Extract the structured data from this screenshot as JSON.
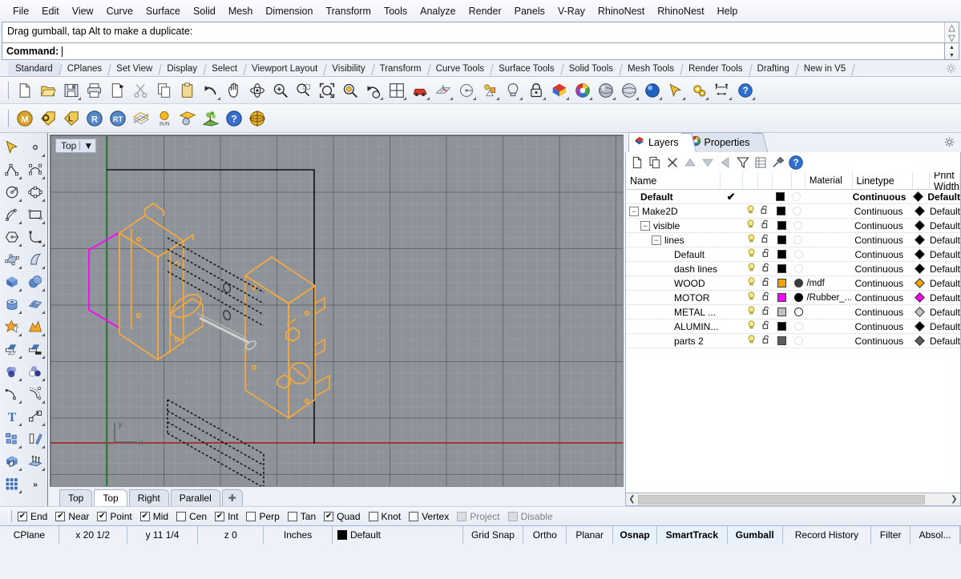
{
  "menu": {
    "items": [
      "File",
      "Edit",
      "View",
      "Curve",
      "Surface",
      "Solid",
      "Mesh",
      "Dimension",
      "Transform",
      "Tools",
      "Analyze",
      "Render",
      "Panels",
      "V-Ray",
      "RhinoNest",
      "RhinoNest",
      "Help"
    ]
  },
  "command": {
    "history": "Drag gumball, tap Alt to make a duplicate:",
    "prompt_label": "Command:",
    "input_value": "",
    "input_placeholder": ""
  },
  "toolbar_tabs": {
    "items": [
      "Standard",
      "CPlanes",
      "Set View",
      "Display",
      "Select",
      "Viewport Layout",
      "Visibility",
      "Transform",
      "Curve Tools",
      "Surface Tools",
      "Solid Tools",
      "Mesh Tools",
      "Render Tools",
      "Drafting",
      "New in V5"
    ],
    "active": "Standard",
    "options_icon": "gear-icon"
  },
  "main_toolbar_row1": [
    {
      "icon": "new-file-icon",
      "flyout": false
    },
    {
      "icon": "open-folder-icon",
      "flyout": false
    },
    {
      "icon": "save-icon",
      "flyout": true
    },
    {
      "icon": "print-icon",
      "flyout": false
    },
    {
      "icon": "properties-page-icon",
      "flyout": false
    },
    {
      "icon": "cut-scissors-icon",
      "flyout": false
    },
    {
      "icon": "copy-icon",
      "flyout": false
    },
    {
      "icon": "paste-clipboard-icon",
      "flyout": false
    },
    {
      "icon": "undo-arrow-icon",
      "flyout": true
    },
    {
      "icon": "pan-hand-icon",
      "flyout": false
    },
    {
      "icon": "rotate-view-icon",
      "flyout": false
    },
    {
      "icon": "zoom-in-icon",
      "flyout": false
    },
    {
      "icon": "zoom-window-icon",
      "flyout": false
    },
    {
      "icon": "zoom-extents-icon",
      "flyout": false
    },
    {
      "icon": "zoom-selected-icon",
      "flyout": false
    },
    {
      "icon": "zoom-dynamic-icon",
      "flyout": true
    },
    {
      "icon": "four-viewport-icon",
      "flyout": true
    },
    {
      "icon": "named-view-car-icon",
      "flyout": true
    },
    {
      "icon": "cplane-grid-icon",
      "flyout": true
    },
    {
      "icon": "set-cplane-icon",
      "flyout": true
    },
    {
      "icon": "layout-objects-icon",
      "flyout": true
    },
    {
      "icon": "light-bulb-icon",
      "flyout": true
    },
    {
      "icon": "lock-icon",
      "flyout": true
    },
    {
      "icon": "render-color-icon",
      "flyout": true
    },
    {
      "icon": "color-wheel-icon",
      "flyout": true
    },
    {
      "icon": "shaded-sphere-icon",
      "flyout": true
    },
    {
      "icon": "ghosted-sphere-icon",
      "flyout": true
    },
    {
      "icon": "rendered-sphere-icon",
      "flyout": true
    },
    {
      "icon": "select-arrow-icon",
      "flyout": true
    },
    {
      "icon": "options-gears-icon",
      "flyout": true
    },
    {
      "icon": "dimension-icon",
      "flyout": true
    },
    {
      "icon": "help-icon",
      "flyout": true
    }
  ],
  "main_toolbar_row2": [
    {
      "icon": "m-badge-icon"
    },
    {
      "icon": "o-tag-icon"
    },
    {
      "icon": "l-tag-icon"
    },
    {
      "icon": "r-render-icon"
    },
    {
      "icon": "rt-realtime-icon"
    },
    {
      "icon": "mesh-lines-icon"
    },
    {
      "icon": "sun-icon"
    },
    {
      "icon": "ground-plane-icon"
    },
    {
      "icon": "plant-library-icon"
    },
    {
      "icon": "help-question-icon"
    },
    {
      "icon": "target-globe-icon"
    }
  ],
  "left_toolbar": [
    {
      "icon": "select-arrow-icon",
      "flyout": false
    },
    {
      "icon": "point-object-icon",
      "flyout": true
    },
    {
      "icon": "polyline-icon",
      "flyout": true
    },
    {
      "icon": "control-point-curve-icon",
      "flyout": true
    },
    {
      "icon": "circle-icon",
      "flyout": true
    },
    {
      "icon": "ellipse-icon",
      "flyout": true
    },
    {
      "icon": "arc-icon",
      "flyout": true
    },
    {
      "icon": "rectangle-icon",
      "flyout": true
    },
    {
      "icon": "polygon-icon",
      "flyout": true
    },
    {
      "icon": "curve-fillet-icon",
      "flyout": true
    },
    {
      "icon": "surface-from-points-icon",
      "flyout": true
    },
    {
      "icon": "surface-sweep-icon",
      "flyout": true
    },
    {
      "icon": "box-solid-icon",
      "flyout": true
    },
    {
      "icon": "sphere-solid-icon",
      "flyout": true
    },
    {
      "icon": "cylinder-solid-icon",
      "flyout": true
    },
    {
      "icon": "mesh-plane-icon",
      "flyout": true
    },
    {
      "icon": "boolean-union-icon",
      "flyout": true
    },
    {
      "icon": "explode-icon",
      "flyout": true
    },
    {
      "icon": "trim-icon",
      "flyout": true
    },
    {
      "icon": "split-icon",
      "flyout": true
    },
    {
      "icon": "boolean-difference-icon",
      "flyout": true
    },
    {
      "icon": "boolean-intersection-icon",
      "flyout": true
    },
    {
      "icon": "fillet-curve-icon",
      "flyout": true
    },
    {
      "icon": "offset-curve-icon",
      "flyout": true
    },
    {
      "icon": "text-tool-icon",
      "flyout": true
    },
    {
      "icon": "scale-icon",
      "flyout": true
    },
    {
      "icon": "group-objects-icon",
      "flyout": true
    },
    {
      "icon": "mirror-icon",
      "flyout": true
    },
    {
      "icon": "cap-solid-icon",
      "flyout": true
    },
    {
      "icon": "extrude-icon",
      "flyout": true
    },
    {
      "icon": "array-icon",
      "flyout": true
    },
    {
      "icon": "more-tools-icon",
      "flyout": false
    }
  ],
  "viewport": {
    "label": "Top",
    "dropdown_icon": "chevron-down-icon",
    "axis_x_label": "x",
    "axis_y_label": "y",
    "background_color": "#8e9399",
    "x_axis_color": "#9e3a3a",
    "y_axis_color": "#2f7a36",
    "model_color": "#f5a83c",
    "model_selected_color": "#ff00ff",
    "tabs": [
      {
        "label": "Top",
        "active": false
      },
      {
        "label": "Top",
        "active": true
      },
      {
        "label": "Right",
        "active": false
      },
      {
        "label": "Parallel",
        "active": false
      },
      {
        "label": "+",
        "active": false
      }
    ]
  },
  "layers_panel": {
    "tabs": [
      {
        "label": "Layers",
        "icon": "layers-icon",
        "active": true
      },
      {
        "label": "Properties",
        "icon": "properties-icon",
        "active": false
      }
    ],
    "options_icon": "gear-icon",
    "toolbar": [
      {
        "icon": "new-layer-icon"
      },
      {
        "icon": "duplicate-layer-icon"
      },
      {
        "icon": "delete-layer-icon"
      },
      {
        "icon": "move-up-icon"
      },
      {
        "icon": "move-down-icon"
      },
      {
        "icon": "move-left-icon"
      },
      {
        "icon": "filter-icon"
      },
      {
        "icon": "layer-panel-icon"
      },
      {
        "icon": "tools-hammer-icon"
      },
      {
        "icon": "help-icon"
      }
    ],
    "columns": [
      "Name",
      "",
      "",
      "",
      "Material",
      "Linetype",
      "",
      "Print Width"
    ],
    "rows": [
      {
        "name": "Default",
        "indent": 0,
        "expander": "none",
        "current": true,
        "vis": false,
        "lock": false,
        "color": "#000000",
        "mat_circle": "empty",
        "material": "",
        "linetype": "Continuous",
        "pw_color": "#000000",
        "printwidth": "Default",
        "bold": true
      },
      {
        "name": "Make2D",
        "indent": 0,
        "expander": "minus",
        "current": false,
        "vis": true,
        "lock": true,
        "color": "#000000",
        "mat_circle": "empty",
        "material": "",
        "linetype": "Continuous",
        "pw_color": "#000000",
        "printwidth": "Default",
        "bold": false
      },
      {
        "name": "visible",
        "indent": 1,
        "expander": "minus",
        "current": false,
        "vis": true,
        "lock": true,
        "color": "#000000",
        "mat_circle": "empty",
        "material": "",
        "linetype": "Continuous",
        "pw_color": "#000000",
        "printwidth": "Default",
        "bold": false
      },
      {
        "name": "lines",
        "indent": 2,
        "expander": "minus",
        "current": false,
        "vis": true,
        "lock": true,
        "color": "#000000",
        "mat_circle": "empty",
        "material": "",
        "linetype": "Continuous",
        "pw_color": "#000000",
        "printwidth": "Default",
        "bold": false
      },
      {
        "name": "Default",
        "indent": 3,
        "expander": "none",
        "current": false,
        "vis": true,
        "lock": true,
        "color": "#000000",
        "mat_circle": "empty",
        "material": "",
        "linetype": "Continuous",
        "pw_color": "#000000",
        "printwidth": "Default",
        "bold": false
      },
      {
        "name": "dash lines",
        "indent": 3,
        "expander": "none",
        "current": false,
        "vis": true,
        "lock": true,
        "color": "#000000",
        "mat_circle": "empty",
        "material": "",
        "linetype": "Continuous",
        "pw_color": "#000000",
        "printwidth": "Default",
        "bold": false
      },
      {
        "name": "WOOD",
        "indent": 3,
        "expander": "none",
        "current": false,
        "vis": true,
        "lock": true,
        "color": "#f5a300",
        "mat_circle": "#3b3b3b",
        "material": "/mdf",
        "linetype": "Continuous",
        "pw_color": "#f5a300",
        "printwidth": "Default",
        "bold": false
      },
      {
        "name": "MOTOR",
        "indent": 3,
        "expander": "none",
        "current": false,
        "vis": true,
        "lock": true,
        "color": "#ff00ff",
        "mat_circle": "#000000",
        "material": "/Rubber_...",
        "linetype": "Continuous",
        "pw_color": "#ff00ff",
        "printwidth": "Default",
        "bold": false
      },
      {
        "name": "METAL ...",
        "indent": 3,
        "expander": "none",
        "current": false,
        "vis": true,
        "lock": true,
        "color": "#c0c0c0",
        "mat_circle": "white",
        "material": "",
        "linetype": "Continuous",
        "pw_color": "#c6c6c6",
        "printwidth": "Default",
        "bold": false
      },
      {
        "name": "ALUMIN...",
        "indent": 3,
        "expander": "none",
        "current": false,
        "vis": true,
        "lock": true,
        "color": "#000000",
        "mat_circle": "empty",
        "material": "",
        "linetype": "Continuous",
        "pw_color": "#000000",
        "printwidth": "Default",
        "bold": false
      },
      {
        "name": "parts 2",
        "indent": 3,
        "expander": "none",
        "current": false,
        "vis": true,
        "lock": true,
        "color": "#5e5e5e",
        "mat_circle": "empty",
        "material": "",
        "linetype": "Continuous",
        "pw_color": "#5e5e5e",
        "printwidth": "Default",
        "bold": false
      }
    ]
  },
  "osnap": {
    "items": [
      {
        "label": "End",
        "checked": true,
        "disabled": false
      },
      {
        "label": "Near",
        "checked": true,
        "disabled": false
      },
      {
        "label": "Point",
        "checked": true,
        "disabled": false
      },
      {
        "label": "Mid",
        "checked": true,
        "disabled": false
      },
      {
        "label": "Cen",
        "checked": false,
        "disabled": false
      },
      {
        "label": "Int",
        "checked": true,
        "disabled": false
      },
      {
        "label": "Perp",
        "checked": false,
        "disabled": false
      },
      {
        "label": "Tan",
        "checked": false,
        "disabled": false
      },
      {
        "label": "Quad",
        "checked": true,
        "disabled": false
      },
      {
        "label": "Knot",
        "checked": false,
        "disabled": false
      },
      {
        "label": "Vertex",
        "checked": false,
        "disabled": false
      },
      {
        "label": "Project",
        "checked": false,
        "disabled": true
      },
      {
        "label": "Disable",
        "checked": false,
        "disabled": true
      }
    ]
  },
  "statusbar": {
    "cplane": "CPlane",
    "x": "x 20 1/2",
    "y": "y 11 1/4",
    "z": "z 0",
    "units": "Inches",
    "layer": "Default",
    "layer_color": "#000000",
    "toggles": [
      {
        "label": "Grid Snap",
        "on": false,
        "bold": false
      },
      {
        "label": "Ortho",
        "on": false,
        "bold": false
      },
      {
        "label": "Planar",
        "on": false,
        "bold": false
      },
      {
        "label": "Osnap",
        "on": true,
        "bold": true
      },
      {
        "label": "SmartTrack",
        "on": true,
        "bold": true
      },
      {
        "label": "Gumball",
        "on": true,
        "bold": true
      },
      {
        "label": "Record History",
        "on": false,
        "bold": false
      },
      {
        "label": "Filter",
        "on": false,
        "bold": false
      },
      {
        "label": "Absol...",
        "on": false,
        "bold": false
      }
    ]
  }
}
